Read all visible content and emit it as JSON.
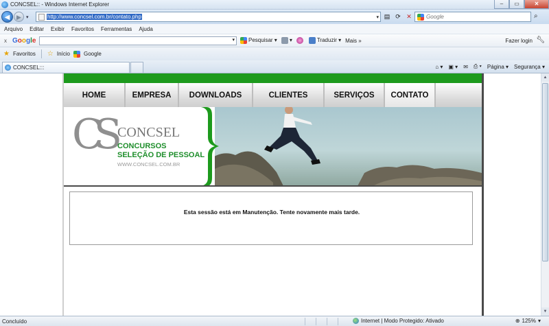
{
  "window": {
    "title": "CONCSEL:: - Windows Internet Explorer",
    "buttons": [
      "–",
      "▭",
      "✕"
    ]
  },
  "address": {
    "url": "http://www.concsel.com.br/contato.php",
    "search_placeholder": "Google"
  },
  "menu": [
    "Arquivo",
    "Editar",
    "Exibir",
    "Favoritos",
    "Ferramentas",
    "Ajuda"
  ],
  "google_toolbar": {
    "close": "x",
    "logo": "Google",
    "search_label": "Pesquisar",
    "translate_label": "Traduzir",
    "more_label": "Mais »",
    "login_label": "Fazer login"
  },
  "favorites": {
    "label": "Favoritos",
    "items": [
      "Início",
      "Google"
    ]
  },
  "tab": {
    "title": "CONCSEL:::"
  },
  "command_bar": {
    "page_label": "Página",
    "security_label": "Segurança"
  },
  "site": {
    "nav": [
      "HOME",
      "EMPRESA",
      "DOWNLOADS",
      "CLIENTES",
      "SERVIÇOS",
      "CONTATO"
    ],
    "active_nav": "CONTATO",
    "logo": {
      "letters": "CS",
      "name": "CONCSEL",
      "line1": "CONCURSOS",
      "line2": "SELEÇÃO DE PESSOAL",
      "url": "WWW.CONCSEL.COM.BR"
    },
    "message": "Esta sessão está em Manutenção. Tente novamente mais tarde.",
    "colors": {
      "brand_green": "#1d9a1d",
      "logo_green": "#1e8e2b",
      "logo_gray": "#8f8f8f"
    }
  },
  "status": {
    "text": "Concluído",
    "zone": "Internet | Modo Protegido: Ativado",
    "zoom": "125%"
  }
}
